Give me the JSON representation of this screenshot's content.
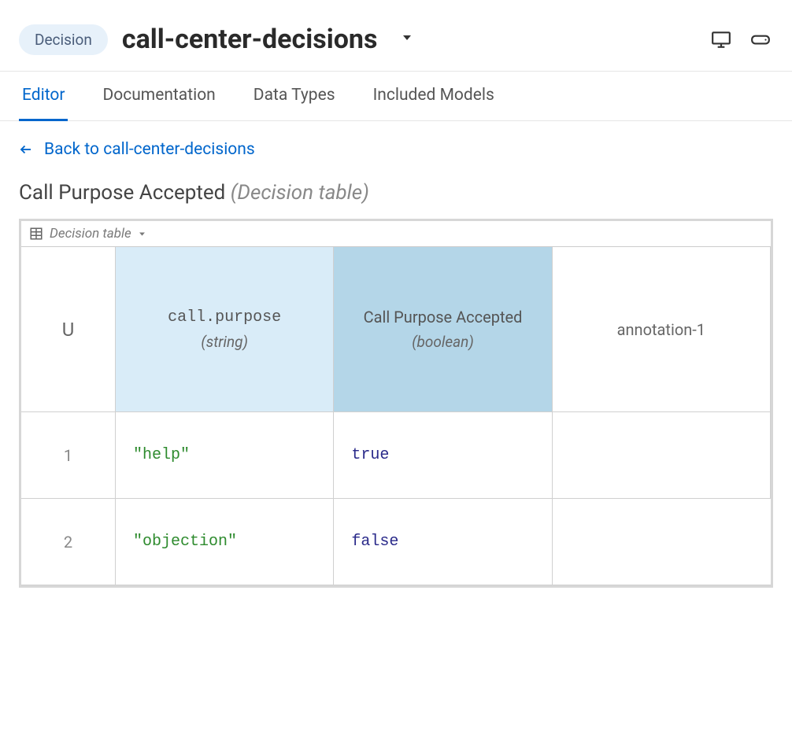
{
  "header": {
    "badge": "Decision",
    "title": "call-center-decisions"
  },
  "tabs": [
    {
      "label": "Editor",
      "active": true
    },
    {
      "label": "Documentation",
      "active": false
    },
    {
      "label": "Data Types",
      "active": false
    },
    {
      "label": "Included Models",
      "active": false
    }
  ],
  "back": {
    "label": "Back to call-center-decisions"
  },
  "section": {
    "title": "Call Purpose Accepted",
    "subtitle": "(Decision table)"
  },
  "dt": {
    "toolbarLabel": "Decision table",
    "hitPolicy": "U",
    "columns": {
      "input": {
        "name": "call.purpose",
        "type": "(string)"
      },
      "output": {
        "name": "Call Purpose Accepted",
        "type": "(boolean)"
      },
      "annotation": {
        "name": "annotation-1"
      }
    },
    "rows": [
      {
        "index": "1",
        "input": "\"help\"",
        "output": "true",
        "annotation": ""
      },
      {
        "index": "2",
        "input": "\"objection\"",
        "output": "false",
        "annotation": ""
      }
    ]
  }
}
